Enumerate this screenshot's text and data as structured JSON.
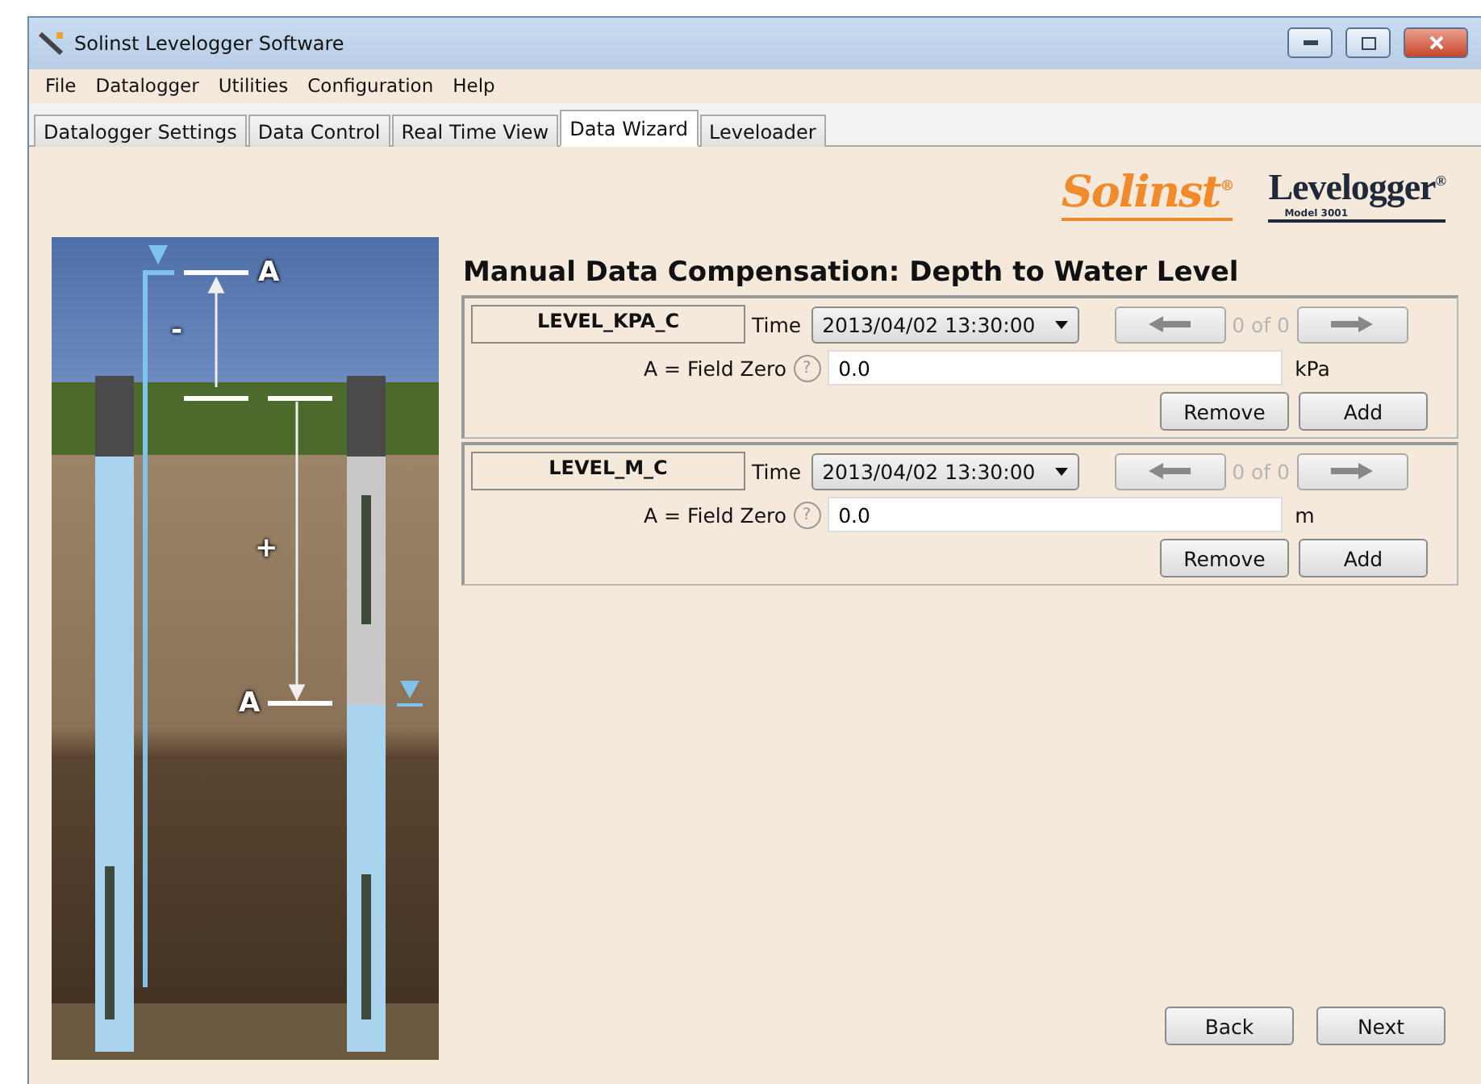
{
  "window": {
    "title": "Solinst Levelogger Software"
  },
  "menu": [
    "File",
    "Datalogger",
    "Utilities",
    "Configuration",
    "Help"
  ],
  "tabs": [
    {
      "label": "Datalogger Settings",
      "selected": false
    },
    {
      "label": "Data Control",
      "selected": false
    },
    {
      "label": "Real Time View",
      "selected": false
    },
    {
      "label": "Data Wizard",
      "selected": true
    },
    {
      "label": "Leveloader",
      "selected": false
    }
  ],
  "logos": {
    "brand": "Solinst",
    "brand_mark": "®",
    "product": "Levelogger",
    "product_mark": "®",
    "model": "Model 3001"
  },
  "diagram": {
    "top_label": "A",
    "minus": "-",
    "plus": "+",
    "bottom_label": "A"
  },
  "heading": "Manual Data Compensation: Depth to Water Level",
  "entries": [
    {
      "name": "LEVEL_KPA_C",
      "time_label": "Time",
      "time": "2013/04/02 13:30:00",
      "counter": "0 of 0",
      "field_label": "A = Field Zero",
      "help": "?",
      "value": "0.0",
      "unit": "kPa",
      "buttons": [
        "Remove",
        "Add"
      ]
    },
    {
      "name": "LEVEL_M_C",
      "time_label": "Time",
      "time": "2013/04/02 13:30:00",
      "counter": "0 of 0",
      "field_label": "A = Field Zero",
      "help": "?",
      "value": "0.0",
      "unit": "m",
      "buttons": [
        "Remove",
        "Add"
      ]
    }
  ],
  "buttons": [
    "Back",
    "Next"
  ]
}
